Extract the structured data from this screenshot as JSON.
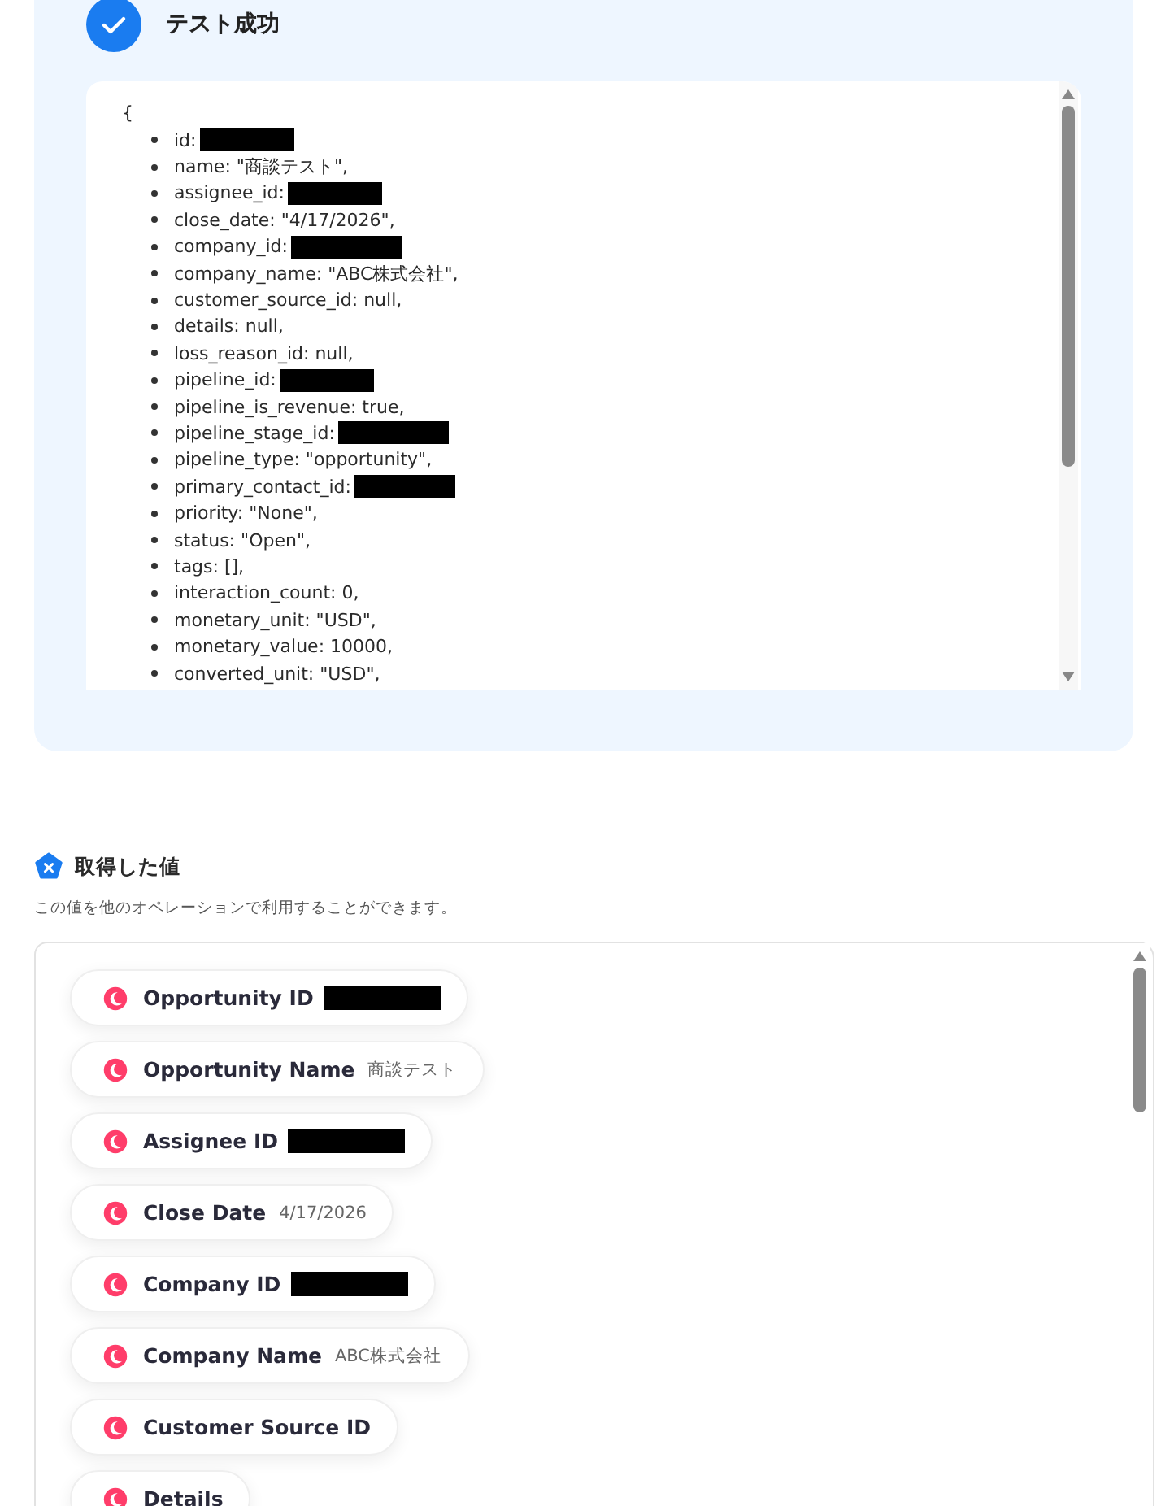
{
  "result": {
    "title": "テスト成功",
    "open_brace": "{",
    "lines": [
      {
        "text": "id:",
        "redacted": true
      },
      {
        "text": "name: \"商談テスト\",",
        "redacted": false
      },
      {
        "text": "assignee_id:",
        "redacted": true
      },
      {
        "text": "close_date: \"4/17/2026\",",
        "redacted": false
      },
      {
        "text": "company_id:",
        "redacted": true
      },
      {
        "text": "company_name: \"ABC株式会社\",",
        "redacted": false
      },
      {
        "text": "customer_source_id: null,",
        "redacted": false
      },
      {
        "text": "details: null,",
        "redacted": false
      },
      {
        "text": "loss_reason_id: null,",
        "redacted": false
      },
      {
        "text": "pipeline_id:",
        "redacted": true
      },
      {
        "text": "pipeline_is_revenue: true,",
        "redacted": false
      },
      {
        "text": "pipeline_stage_id:",
        "redacted": true
      },
      {
        "text": "pipeline_type: \"opportunity\",",
        "redacted": false
      },
      {
        "text": "primary_contact_id:",
        "redacted": true
      },
      {
        "text": "priority: \"None\",",
        "redacted": false
      },
      {
        "text": "status: \"Open\",",
        "redacted": false
      },
      {
        "text": "tags: [],",
        "redacted": false
      },
      {
        "text": "interaction_count: 0,",
        "redacted": false
      },
      {
        "text": "monetary_unit: \"USD\",",
        "redacted": false
      },
      {
        "text": "monetary_value: 10000,",
        "redacted": false
      },
      {
        "text": "converted_unit: \"USD\",",
        "redacted": false
      }
    ]
  },
  "values": {
    "title": "取得した値",
    "description": "この値を他のオペレーションで利用することができます。",
    "items": [
      {
        "label": "Opportunity ID",
        "redacted": true
      },
      {
        "label": "Opportunity Name",
        "value": "商談テスト",
        "redacted": false
      },
      {
        "label": "Assignee ID",
        "redacted": true
      },
      {
        "label": "Close Date",
        "value": "4/17/2026",
        "redacted": false
      },
      {
        "label": "Company ID",
        "redacted": true
      },
      {
        "label": "Company Name",
        "value": "ABC株式会社",
        "redacted": false
      },
      {
        "label": "Customer Source ID",
        "redacted": false
      },
      {
        "label": "Details",
        "redacted": false
      }
    ]
  }
}
